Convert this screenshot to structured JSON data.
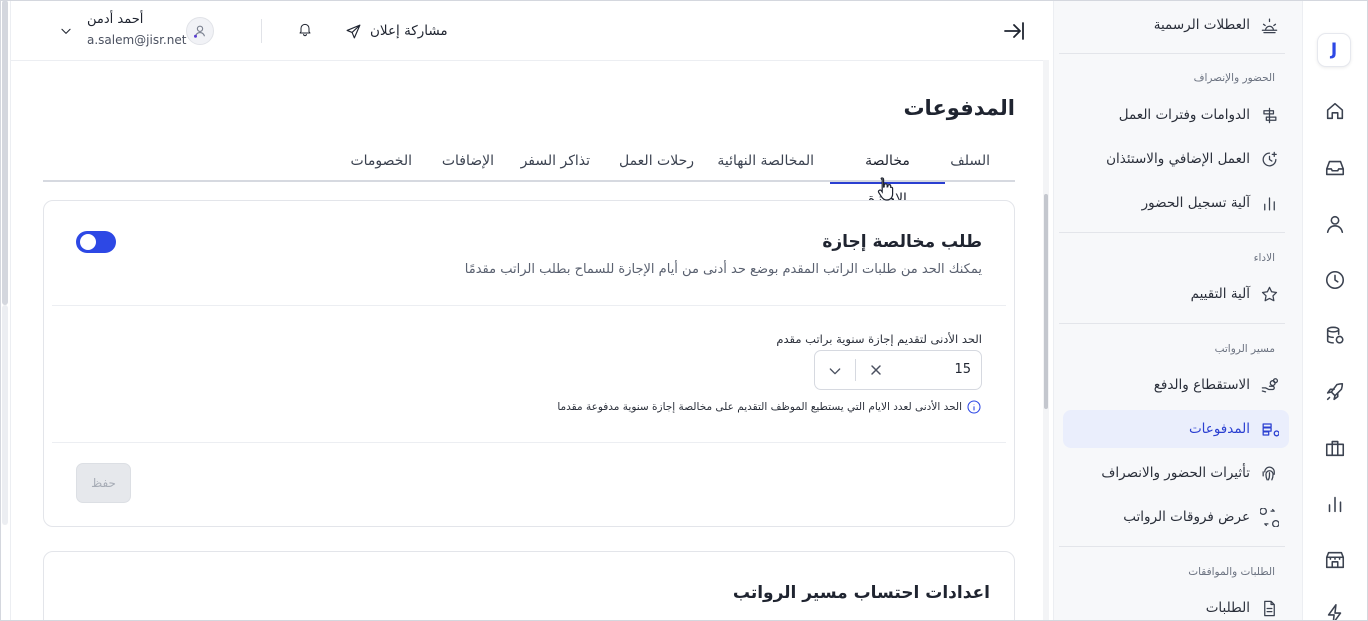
{
  "header": {
    "share_announcement": "مشاركة إعلان",
    "user_name": "أحمد أدمن",
    "user_email": "a.salem@jisr.net"
  },
  "page": {
    "title": "المدفوعات"
  },
  "tabs": [
    {
      "label": "السلف",
      "active": false
    },
    {
      "label": "مخالصة الإجازة",
      "active": true
    },
    {
      "label": "المخالصة النهائية",
      "active": false
    },
    {
      "label": "رحلات العمل",
      "active": false
    },
    {
      "label": "تذاكر السفر",
      "active": false
    },
    {
      "label": "الإضافات",
      "active": false
    },
    {
      "label": "الخصومات",
      "active": false
    }
  ],
  "leave_settlement": {
    "title": "طلب مخالصة إجازة",
    "description": "يمكنك الحد من طلبات الراتب المقدم بوضع حد أدنى من أيام الإجازة للسماح بطلب الراتب مقدمًا",
    "toggle_on": true,
    "field_label": "الحد الأدنى لتقديم إجازة سنوية براتب مقدم",
    "field_value": "15",
    "hint": "الحد الأدنى لعدد الايام التي يستطيع الموظف التقديم على مخالصة إجازة سنوية مدفوعة مقدما",
    "save_label": "حفظ"
  },
  "payroll_settings": {
    "title": "اعدادات احتساب مسير الرواتب"
  },
  "menu": {
    "official_holidays": "العطلات الرسمية",
    "section_attendance": "الحضور والإنصراف",
    "shifts": "الدوامات وفترات العمل",
    "overtime": "العمل الإضافي والاستئذان",
    "attendance_mechanism": "آلية تسجيل الحضور",
    "section_performance": "الاداء",
    "evaluation": "آلية التقييم",
    "section_payroll": "مسير الرواتب",
    "deductions": "الاستقطاع والدفع",
    "payments": "المدفوعات",
    "attendance_effects": "تأثيرات الحضور والانصراف",
    "payroll_differences": "عرض فروقات الرواتب",
    "section_requests": "الطلبات والموافقات",
    "requests": "الطلبات"
  },
  "rail": {
    "logo": "J"
  },
  "colors": {
    "accent": "#2d48e5",
    "active_bg": "#eaeefc"
  }
}
